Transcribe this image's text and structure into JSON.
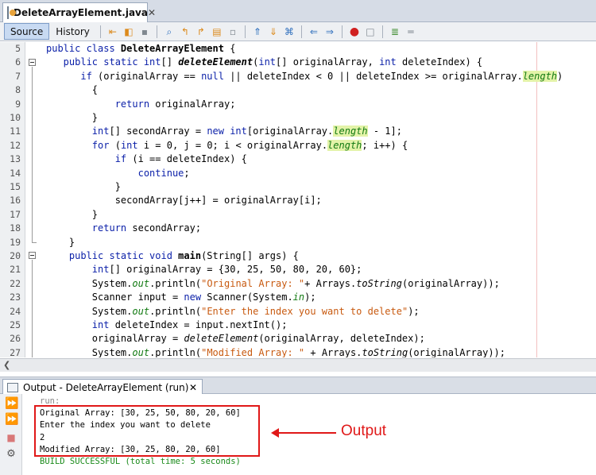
{
  "editor_tab": {
    "title": "DeleteArrayElement.java",
    "close": "✕"
  },
  "toolbar": {
    "source_label": "Source",
    "history_label": "History"
  },
  "code_lines": [
    {
      "num": "5",
      "segs": [
        {
          "t": "public class ",
          "c": "kw"
        },
        {
          "t": "DeleteArrayElement",
          "c": "bld"
        },
        {
          "t": " {",
          "c": ""
        }
      ]
    },
    {
      "num": "6",
      "segs": [
        {
          "t": "   public static int",
          "c": "kw"
        },
        {
          "t": "[] ",
          "c": ""
        },
        {
          "t": "deleteElement",
          "c": "bld it"
        },
        {
          "t": "(",
          "c": ""
        },
        {
          "t": "int",
          "c": "kw"
        },
        {
          "t": "[] originalArray, ",
          "c": ""
        },
        {
          "t": "int",
          "c": "kw"
        },
        {
          "t": " deleteIndex) {",
          "c": ""
        }
      ]
    },
    {
      "num": "7",
      "segs": [
        {
          "t": "      if",
          "c": "kw"
        },
        {
          "t": " (originalArray == ",
          "c": ""
        },
        {
          "t": "null",
          "c": "kw"
        },
        {
          "t": " || deleteIndex < 0 || deleteIndex >= originalArray.",
          "c": ""
        },
        {
          "t": "length",
          "c": "fld hl"
        },
        {
          "t": ")",
          "c": ""
        }
      ]
    },
    {
      "num": "8",
      "segs": [
        {
          "t": "        {",
          "c": ""
        }
      ]
    },
    {
      "num": "9",
      "segs": [
        {
          "t": "            return",
          "c": "kw"
        },
        {
          "t": " originalArray;",
          "c": ""
        }
      ]
    },
    {
      "num": "10",
      "segs": [
        {
          "t": "        }",
          "c": ""
        }
      ]
    },
    {
      "num": "11",
      "segs": [
        {
          "t": "        int",
          "c": "kw"
        },
        {
          "t": "[] secondArray = ",
          "c": ""
        },
        {
          "t": "new int",
          "c": "kw"
        },
        {
          "t": "[originalArray.",
          "c": ""
        },
        {
          "t": "length",
          "c": "fld hl"
        },
        {
          "t": " - 1];",
          "c": ""
        }
      ]
    },
    {
      "num": "12",
      "segs": [
        {
          "t": "        for",
          "c": "kw"
        },
        {
          "t": " (",
          "c": ""
        },
        {
          "t": "int",
          "c": "kw"
        },
        {
          "t": " i = 0, j = 0; i < originalArray.",
          "c": ""
        },
        {
          "t": "length",
          "c": "fld hl"
        },
        {
          "t": "; i++) {",
          "c": ""
        }
      ]
    },
    {
      "num": "13",
      "segs": [
        {
          "t": "            if",
          "c": "kw"
        },
        {
          "t": " (i == deleteIndex) {",
          "c": ""
        }
      ]
    },
    {
      "num": "14",
      "segs": [
        {
          "t": "                continue",
          "c": "kw"
        },
        {
          "t": ";",
          "c": ""
        }
      ]
    },
    {
      "num": "15",
      "segs": [
        {
          "t": "            }",
          "c": ""
        }
      ]
    },
    {
      "num": "16",
      "segs": [
        {
          "t": "            secondArray[j++] = originalArray[i];",
          "c": ""
        }
      ]
    },
    {
      "num": "17",
      "segs": [
        {
          "t": "        }",
          "c": ""
        }
      ]
    },
    {
      "num": "18",
      "segs": [
        {
          "t": "        return",
          "c": "kw"
        },
        {
          "t": " secondArray;",
          "c": ""
        }
      ]
    },
    {
      "num": "19",
      "segs": [
        {
          "t": "    }",
          "c": ""
        }
      ]
    },
    {
      "num": "20",
      "segs": [
        {
          "t": "    public static void ",
          "c": "kw"
        },
        {
          "t": "main",
          "c": "bld"
        },
        {
          "t": "(String[] args) {",
          "c": ""
        }
      ]
    },
    {
      "num": "21",
      "segs": [
        {
          "t": "        int",
          "c": "kw"
        },
        {
          "t": "[] originalArray = {30, 25, 50, 80, 20, 60};",
          "c": ""
        }
      ]
    },
    {
      "num": "22",
      "segs": [
        {
          "t": "        System.",
          "c": ""
        },
        {
          "t": "out",
          "c": "fld"
        },
        {
          "t": ".println(",
          "c": ""
        },
        {
          "t": "\"Original Array: \"",
          "c": "str"
        },
        {
          "t": "+ Arrays.",
          "c": ""
        },
        {
          "t": "toString",
          "c": "it"
        },
        {
          "t": "(originalArray));",
          "c": ""
        }
      ]
    },
    {
      "num": "23",
      "segs": [
        {
          "t": "        Scanner input = ",
          "c": ""
        },
        {
          "t": "new",
          "c": "kw"
        },
        {
          "t": " Scanner(System.",
          "c": ""
        },
        {
          "t": "in",
          "c": "fld"
        },
        {
          "t": ");",
          "c": ""
        }
      ]
    },
    {
      "num": "24",
      "segs": [
        {
          "t": "        System.",
          "c": ""
        },
        {
          "t": "out",
          "c": "fld"
        },
        {
          "t": ".println(",
          "c": ""
        },
        {
          "t": "\"Enter the index you want to delete\"",
          "c": "str"
        },
        {
          "t": ");",
          "c": ""
        }
      ]
    },
    {
      "num": "25",
      "segs": [
        {
          "t": "        int",
          "c": "kw"
        },
        {
          "t": " deleteIndex = input.nextInt();",
          "c": ""
        }
      ]
    },
    {
      "num": "26",
      "segs": [
        {
          "t": "        originalArray = ",
          "c": ""
        },
        {
          "t": "deleteElement",
          "c": "it"
        },
        {
          "t": "(originalArray, deleteIndex);",
          "c": ""
        }
      ]
    },
    {
      "num": "27",
      "segs": [
        {
          "t": "        System.",
          "c": ""
        },
        {
          "t": "out",
          "c": "fld"
        },
        {
          "t": ".println(",
          "c": ""
        },
        {
          "t": "\"Modified Array: \"",
          "c": "str"
        },
        {
          "t": " + Arrays.",
          "c": ""
        },
        {
          "t": "toString",
          "c": "it"
        },
        {
          "t": "(originalArray));",
          "c": ""
        }
      ]
    }
  ],
  "output": {
    "tab_title": "Output - DeleteArrayElement (run)",
    "tab_close": "✕",
    "lines": [
      {
        "text": "run:",
        "kind": "run"
      },
      {
        "text": "Original Array: [30, 25, 50, 80, 20, 60]",
        "kind": ""
      },
      {
        "text": "Enter the index you want to delete",
        "kind": ""
      },
      {
        "text": "2",
        "kind": ""
      },
      {
        "text": "Modified Array: [30, 25, 80, 20, 60]",
        "kind": ""
      },
      {
        "text": "BUILD SUCCESSFUL (total time: 5 seconds)",
        "kind": "success"
      }
    ]
  },
  "annotation": {
    "label": "Output",
    "color": "#e01818"
  }
}
